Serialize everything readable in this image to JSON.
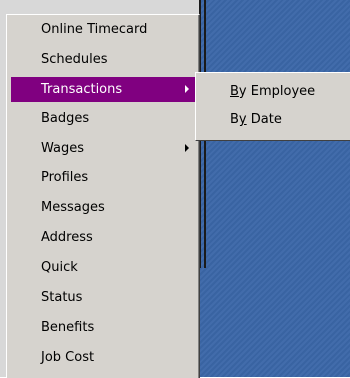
{
  "menu": {
    "items": [
      {
        "label": "Online Timecard"
      },
      {
        "label": "Schedules"
      },
      {
        "label": "Transactions",
        "selected": true,
        "has_submenu": true
      },
      {
        "label": "Badges"
      },
      {
        "label": "Wages",
        "has_submenu": true
      },
      {
        "label": "Profiles"
      },
      {
        "label": "Messages"
      },
      {
        "label": "Address"
      },
      {
        "label": "Quick"
      },
      {
        "label": "Status"
      },
      {
        "label": "Benefits"
      },
      {
        "label": "Job Cost"
      }
    ]
  },
  "submenu": {
    "items": [
      {
        "prefix": "",
        "mnemonic": "B",
        "rest": "y Employee"
      },
      {
        "prefix": "B",
        "mnemonic": "y",
        "rest": " Date"
      }
    ]
  },
  "colors": {
    "highlight": "#800080",
    "menu_bg": "#d6d3ce",
    "desktop": "#3b67a8"
  }
}
